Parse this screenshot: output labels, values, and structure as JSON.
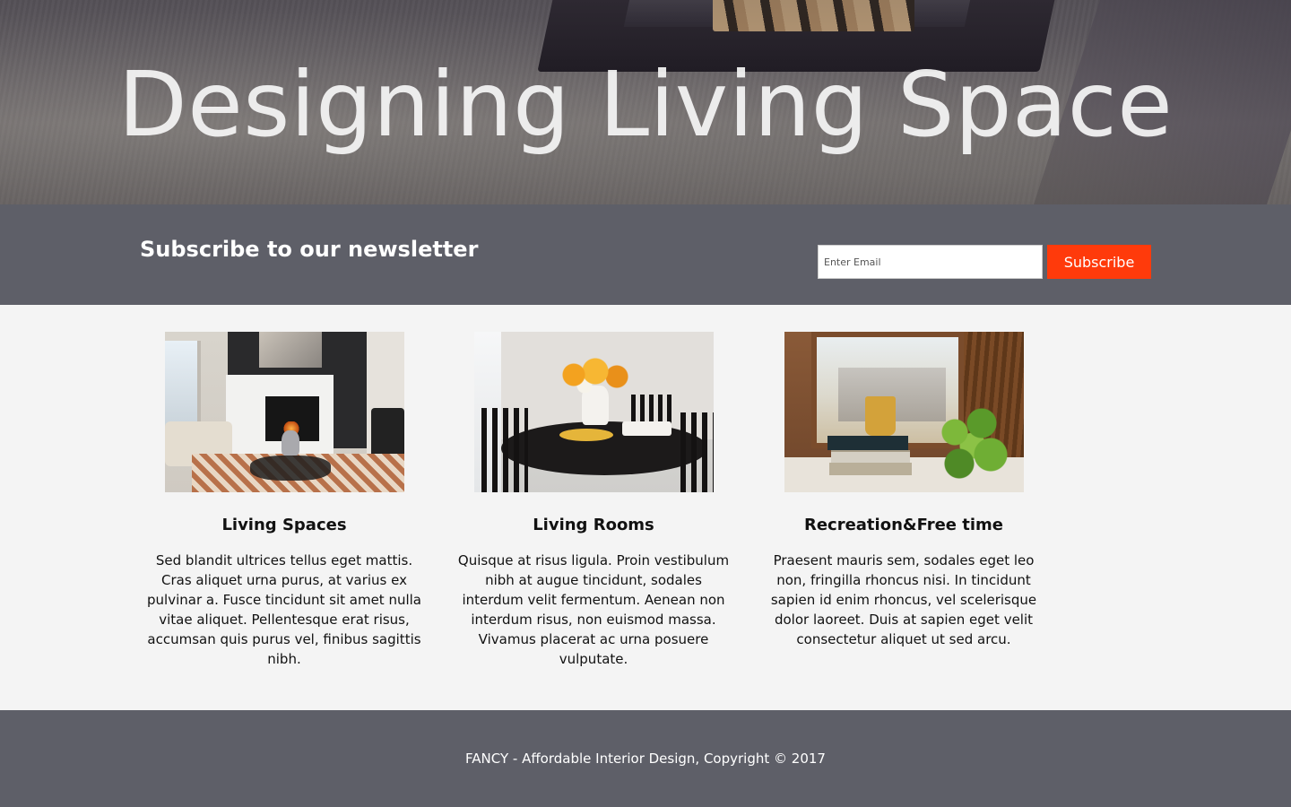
{
  "hero": {
    "title": "Designing Living Space"
  },
  "newsletter": {
    "title": "Subscribe to our newsletter",
    "email_placeholder": "Enter Email",
    "subscribe_label": "Subscribe",
    "accent_color": "#ff3a0b",
    "band_color": "#5e5f68"
  },
  "features": [
    {
      "heading": "Living Spaces",
      "text": "Sed blandit ultrices tellus eget mattis. Cras aliquet urna purus, at varius ex pulvinar a. Fusce tincidunt sit amet nulla vitae aliquet. Pellentesque erat risus, accumsan quis purus vel, finibus sagittis nibh."
    },
    {
      "heading": "Living Rooms",
      "text": "Quisque at risus ligula. Proin vestibulum nibh at augue tincidunt, sodales interdum velit fermentum. Aenean non interdum risus, non euismod massa. Vivamus placerat ac urna posuere vulputate."
    },
    {
      "heading": "Recreation&Free time",
      "text": "Praesent mauris sem, sodales eget leo non, fringilla rhoncus nisi. In tincidunt sapien id enim rhoncus, vel scelerisque dolor laoreet. Duis at sapien eget velit consectetur aliquet ut sed arcu."
    }
  ],
  "footer": {
    "text": "FANCY - Affordable Interior Design, Copyright © 2017"
  }
}
